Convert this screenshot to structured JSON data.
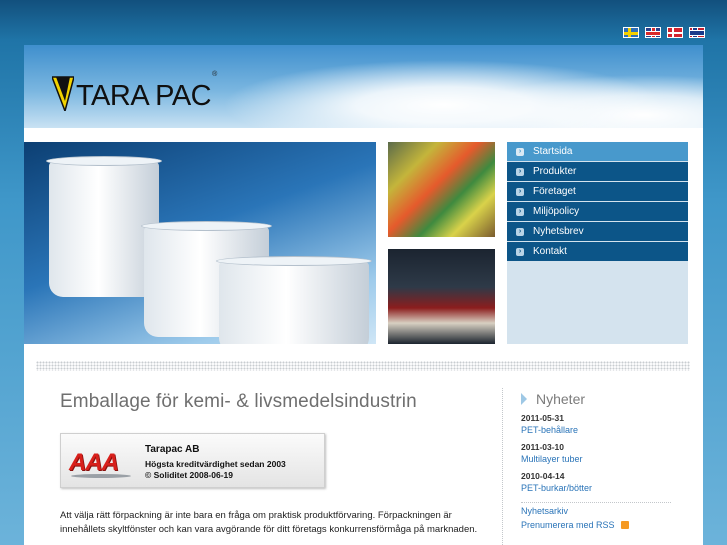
{
  "flags": [
    {
      "name": "swedish-flag-icon",
      "lang": "sv"
    },
    {
      "name": "uk-flag-icon",
      "lang": "en"
    },
    {
      "name": "danish-flag-icon",
      "lang": "da"
    },
    {
      "name": "norwegian-flag-icon",
      "lang": "no"
    }
  ],
  "logo": {
    "text": "TARA PAC",
    "reg": "®"
  },
  "nav": {
    "items": [
      {
        "label": "Startsida",
        "active": true
      },
      {
        "label": "Produkter"
      },
      {
        "label": "Företaget"
      },
      {
        "label": "Miljöpolicy"
      },
      {
        "label": "Nyhetsbrev"
      },
      {
        "label": "Kontakt"
      }
    ]
  },
  "main": {
    "title": "Emballage för kemi- & livsmedelsindustrin",
    "rating": {
      "badge": "AAA",
      "company": "Tarapac AB",
      "line1": "Högsta kreditvärdighet sedan 2003",
      "line2": "© Soliditet 2008-06-19"
    },
    "body": "Att välja rätt förpackning är inte bara en fråga om praktisk produktförvaring. Förpackningen är innehållets skyltfönster och kan vara avgörande för ditt företags konkurrensförmåga på marknaden."
  },
  "news": {
    "title": "Nyheter",
    "items": [
      {
        "date": "2011-05-31",
        "link": "PET-behållare"
      },
      {
        "date": "2011-03-10",
        "link": "Multilayer tuber"
      },
      {
        "date": "2010-04-14",
        "link": "PET-burkar/bötter"
      }
    ],
    "archive": "Nyhetsarkiv",
    "rss": "Prenumerera med RSS"
  },
  "colors": {
    "nav": "#0c5588",
    "nav_active": "#4899cc",
    "link": "#2a74b8",
    "badge_red": "#d8201b"
  }
}
